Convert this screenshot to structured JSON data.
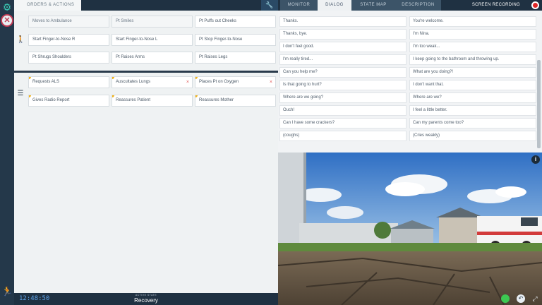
{
  "topbar": {
    "tabs": {
      "orders": "ORDERS & ACTIONS",
      "monitor": "MONITOR",
      "dialog": "DIALOG",
      "statemap": "STATE MAP",
      "description": "DESCRIPTION"
    },
    "recording_label": "SCREEN RECORDING"
  },
  "orders": {
    "movement_row": [
      "Moves to Ambulance",
      "Pt Smiles",
      "Pt Puffs out Cheeks"
    ],
    "row2": [
      "Start Finger-to-Nose R",
      "Start Finger-to-Nose L",
      "Pt Stop Finger-to-Nose"
    ],
    "row3": [
      "Pt Shrugs Shoulders",
      "Pt Raises Arms",
      "Pt Raises Legs"
    ],
    "actions_row1": [
      "Requests ALS",
      "Auscultates Lungs",
      "Places Pt on Oxygen"
    ],
    "actions_row2": [
      "Gives Radio Report",
      "Reassures Patient",
      "Reassures Mother"
    ],
    "x_symbol": "×"
  },
  "bottom": {
    "clock": "12:48:50",
    "state_caption": "ACTIVE STATE",
    "state_name": "Recovery"
  },
  "dialog": {
    "left": [
      "Thanks.",
      "Thanks, bye.",
      "I don't feel good.",
      "I'm really tired...",
      "Can you help me?",
      "Is that going to hurt?",
      "Where are we going?",
      "Ouch!",
      "Can I have some crackers?",
      "(coughs)"
    ],
    "right": [
      "You're welcome.",
      "I'm Nina.",
      "I'm too weak...",
      "I keep going to the bathroom and throwing up.",
      "What are you doing?!",
      "I don't want that.",
      "Where are we?",
      "I feel a little better.",
      "Can my parents come too?",
      "(Cries weakly)"
    ]
  },
  "icons": {
    "gear": "⚙",
    "no_movement": "✕",
    "walking": "🚶",
    "list": "☰",
    "wrench": "🔧",
    "running": "🏃",
    "info": "i",
    "undo": "↶",
    "expand": "⤢"
  },
  "colors": {
    "accent_teal": "#39c6b2",
    "navy": "#1f3142",
    "progress_blue": "#2e8fd4",
    "star_yellow": "#f2b31b",
    "record_red": "#e02727",
    "status_green": "#3cc852"
  }
}
